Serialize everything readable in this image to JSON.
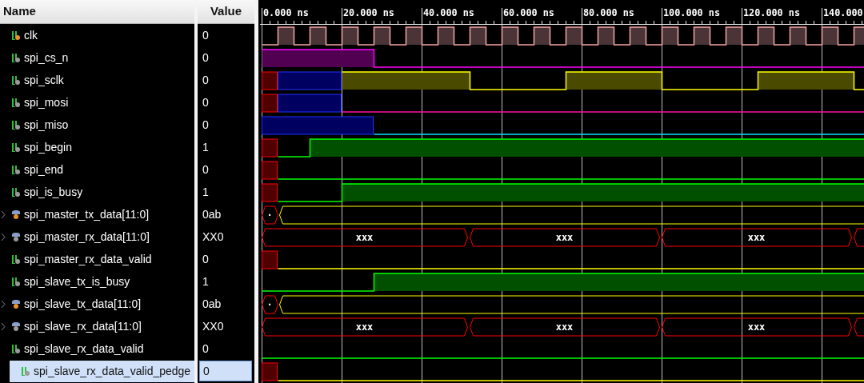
{
  "columns": {
    "name": "Name",
    "value": "Value"
  },
  "ruler": [
    "0.000 ns",
    "20.000 ns",
    "40.000 ns",
    "60.000 ns",
    "80.000 ns",
    "100.000 ns",
    "120.000 ns",
    "140.000"
  ],
  "signals": [
    {
      "name": "clk",
      "value": "0",
      "kind": "bit",
      "color": "#e8922a",
      "selected": false
    },
    {
      "name": "spi_cs_n",
      "value": "0",
      "kind": "bit",
      "color": "#9a9a9a",
      "selected": false
    },
    {
      "name": "spi_sclk",
      "value": "0",
      "kind": "bit",
      "color": "#9a9a9a",
      "selected": false
    },
    {
      "name": "spi_mosi",
      "value": "0",
      "kind": "bit",
      "color": "#9a9a9a",
      "selected": false
    },
    {
      "name": "spi_miso",
      "value": "0",
      "kind": "bit",
      "color": "#9a9a9a",
      "selected": false
    },
    {
      "name": "spi_begin",
      "value": "1",
      "kind": "bit",
      "color": "#9a9a9a",
      "selected": false
    },
    {
      "name": "spi_end",
      "value": "0",
      "kind": "bit",
      "color": "#9a9a9a",
      "selected": false
    },
    {
      "name": "spi_is_busy",
      "value": "1",
      "kind": "bit",
      "color": "#9a9a9a",
      "selected": false
    },
    {
      "name": "spi_master_tx_data[11:0]",
      "value": "0ab",
      "kind": "bus",
      "color": "#e8922a",
      "expanded": false,
      "selected": false,
      "bus_labels": [
        "·"
      ]
    },
    {
      "name": "spi_master_rx_data[11:0]",
      "value": "XX0",
      "kind": "bus",
      "color": "#9a9a9a",
      "expanded": false,
      "selected": false,
      "bus_labels": [
        "xxx",
        "xxx",
        "xxx"
      ]
    },
    {
      "name": "spi_master_rx_data_valid",
      "value": "0",
      "kind": "bit",
      "color": "#9a9a9a",
      "selected": false
    },
    {
      "name": "spi_slave_tx_is_busy",
      "value": "1",
      "kind": "bit",
      "color": "#9a9a9a",
      "selected": false
    },
    {
      "name": "spi_slave_tx_data[11:0]",
      "value": "0ab",
      "kind": "bus",
      "color": "#e8922a",
      "expanded": false,
      "selected": false,
      "bus_labels": [
        "·"
      ]
    },
    {
      "name": "spi_slave_rx_data[11:0]",
      "value": "XX0",
      "kind": "bus",
      "color": "#9a9a9a",
      "expanded": false,
      "selected": false,
      "bus_labels": [
        "xxx",
        "xxx",
        "xxx"
      ]
    },
    {
      "name": "spi_slave_rx_data_valid",
      "value": "0",
      "kind": "bit",
      "color": "#9a9a9a",
      "selected": false
    },
    {
      "name": "spi_slave_rx_data_valid_pedge",
      "value": "0",
      "kind": "bit",
      "color": "#9a9a9a",
      "selected": true
    }
  ]
}
